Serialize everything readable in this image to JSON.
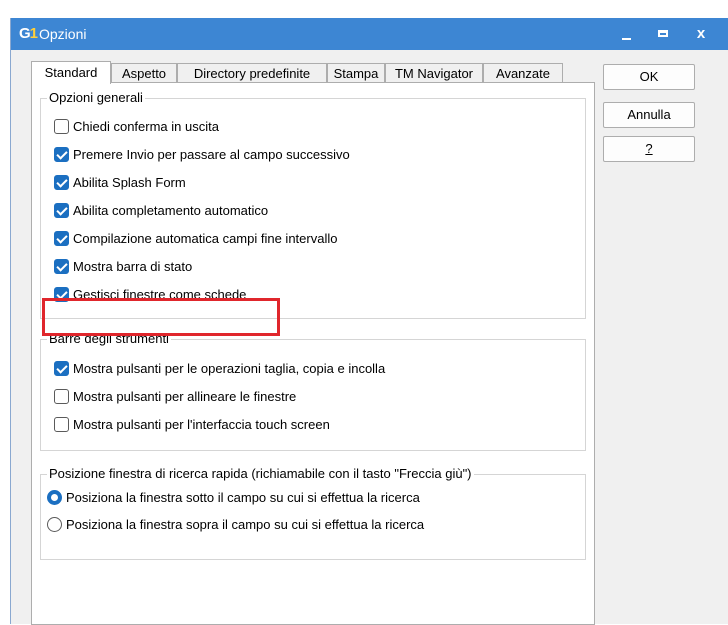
{
  "window": {
    "logo_text": "G1",
    "title": "Opzioni",
    "minimize_glyph": "minimize-icon",
    "maximize_glyph": "maximize-icon",
    "close_glyph": "x"
  },
  "tabs": [
    {
      "label": "Standard",
      "active": true
    },
    {
      "label": "Aspetto"
    },
    {
      "label": "Directory predefinite"
    },
    {
      "label": "Stampa"
    },
    {
      "label": "TM Navigator"
    },
    {
      "label": "Avanzate"
    }
  ],
  "groups": {
    "general": {
      "title": "Opzioni generali",
      "options": [
        {
          "label": "Chiedi conferma in uscita",
          "checked": false
        },
        {
          "label": "Premere Invio per passare al campo successivo",
          "checked": true
        },
        {
          "label": "Abilita Splash Form",
          "checked": true
        },
        {
          "label": "Abilita completamento automatico",
          "checked": true
        },
        {
          "label": "Compilazione automatica campi fine intervallo",
          "checked": true
        },
        {
          "label": "Mostra barra di stato",
          "checked": true
        },
        {
          "label": "Gestisci finestre come schede",
          "checked": true,
          "highlighted": true
        }
      ]
    },
    "toolbars": {
      "title": "Barre degli strumenti",
      "options": [
        {
          "label": "Mostra pulsanti per le operazioni taglia, copia e incolla",
          "checked": true
        },
        {
          "label": "Mostra pulsanti per allineare le finestre",
          "checked": false
        },
        {
          "label": "Mostra pulsanti per l'interfaccia touch screen",
          "checked": false
        }
      ]
    },
    "quick_search": {
      "title": "Posizione finestra di ricerca rapida (richiamabile con il tasto \"Freccia giù\")",
      "options": [
        {
          "label": "Posiziona la finestra sotto il campo su cui si effettua la ricerca",
          "selected": true
        },
        {
          "label": "Posiziona la finestra sopra il campo su cui si effettua la ricerca",
          "selected": false
        }
      ]
    }
  },
  "buttons": {
    "ok": "OK",
    "cancel": "Annulla",
    "help": "?"
  },
  "colors": {
    "titlebar": "#3d86d3",
    "checkbox_checked": "#1b6fc1",
    "highlight": "#e0262c"
  }
}
